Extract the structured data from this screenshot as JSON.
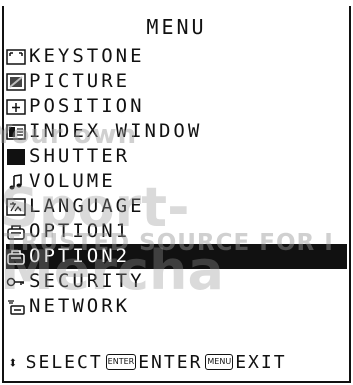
{
  "menu": {
    "title": "MENU",
    "items": [
      {
        "label": "KEYSTONE",
        "icon": "keystone-icon"
      },
      {
        "label": "PICTURE",
        "icon": "picture-icon"
      },
      {
        "label": "POSITION",
        "icon": "position-icon"
      },
      {
        "label": "INDEX WINDOW",
        "icon": "index-window-icon"
      },
      {
        "label": "SHUTTER",
        "icon": "shutter-icon"
      },
      {
        "label": "VOLUME",
        "icon": "volume-icon"
      },
      {
        "label": "LANGUAGE",
        "icon": "language-icon"
      },
      {
        "label": "OPTION1",
        "icon": "option-icon"
      },
      {
        "label": "OPTION2",
        "icon": "option-icon",
        "selected": true
      },
      {
        "label": "SECURITY",
        "icon": "key-icon"
      },
      {
        "label": "NETWORK",
        "icon": "network-icon"
      }
    ],
    "footer": {
      "select": "SELECT",
      "enter_key": "ENTER",
      "enter": "ENTER",
      "menu_key": "MENU",
      "exit": "EXIT"
    }
  },
  "watermark": {
    "line1": "Your own",
    "line2": "Sport-Mercha",
    "line3": "TRUSTED SOURCE FOR I"
  },
  "colors": {
    "background": "#ffffff",
    "text": "#111111",
    "selected_bg": "#111111",
    "selected_text": "#ffffff"
  }
}
